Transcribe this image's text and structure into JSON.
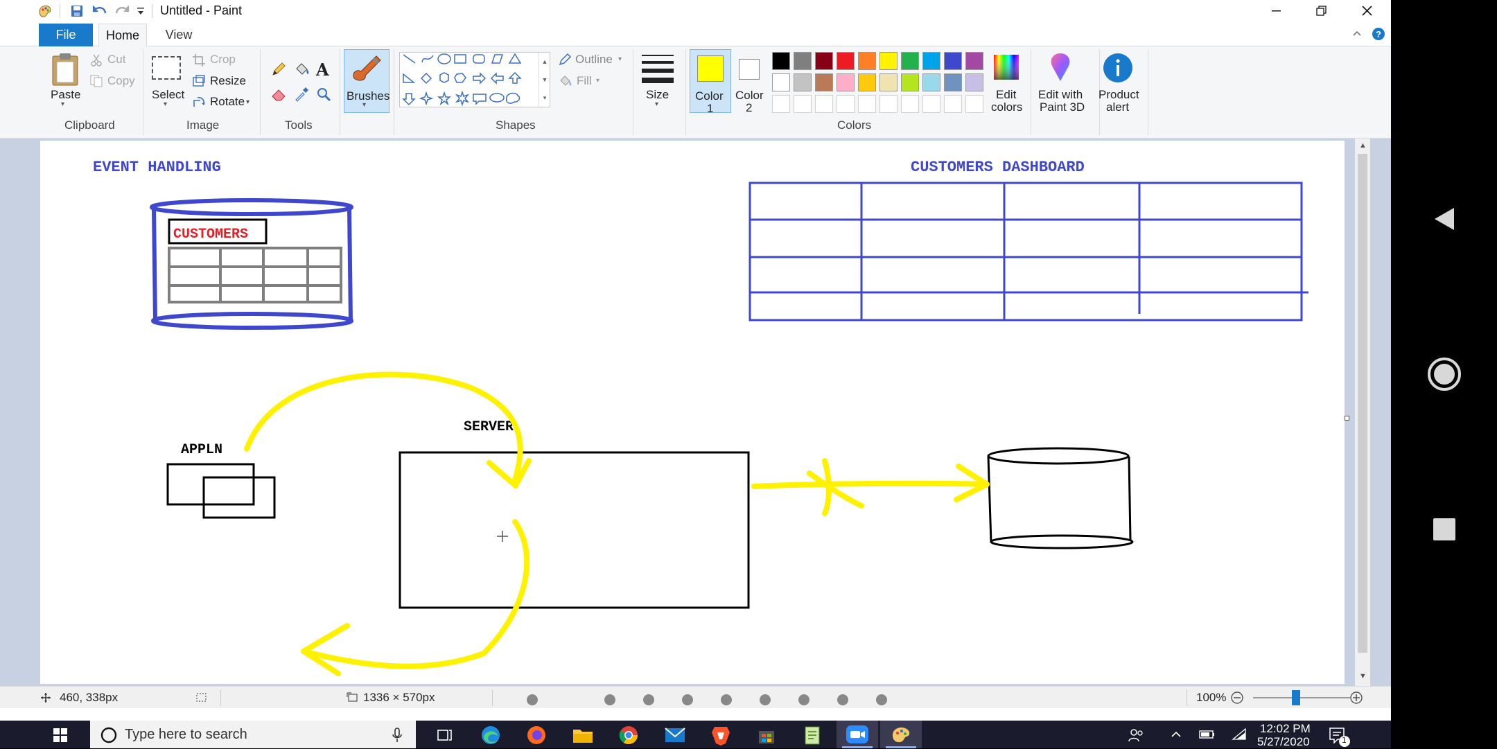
{
  "window": {
    "title": "Untitled - Paint"
  },
  "ribbon": {
    "tabs": [
      "File",
      "Home",
      "View"
    ],
    "clipboard": {
      "paste": "Paste",
      "cut": "Cut",
      "copy": "Copy",
      "group": "Clipboard"
    },
    "image": {
      "select": "Select",
      "crop": "Crop",
      "resize": "Resize",
      "rotate": "Rotate",
      "group": "Image"
    },
    "tools": {
      "group": "Tools",
      "text_glyph": "A"
    },
    "brushes": "Brushes",
    "shapes": {
      "outline": "Outline",
      "fill": "Fill",
      "group": "Shapes"
    },
    "size": "Size",
    "color1": {
      "label": "Color",
      "num": "1",
      "value": "#ffff00"
    },
    "color2": {
      "label": "Color",
      "num": "2",
      "value": "#ffffff"
    },
    "palette_row1": [
      "#000000",
      "#7f7f7f",
      "#880015",
      "#ed1c24",
      "#ff7f27",
      "#fff200",
      "#22b14c",
      "#00a2e8",
      "#3f48cc",
      "#a349a4"
    ],
    "palette_row2": [
      "#ffffff",
      "#c3c3c3",
      "#b97a57",
      "#ffaec9",
      "#ffc90e",
      "#efe4b0",
      "#b5e61d",
      "#99d9ea",
      "#7092be",
      "#c8bfe7"
    ],
    "colors_group": "Colors",
    "edit_colors": [
      "Edit",
      "colors"
    ],
    "edit_paint3d": [
      "Edit with",
      "Paint 3D"
    ],
    "product_alert": [
      "Product",
      "alert"
    ]
  },
  "canvas": {
    "title_left": "EVENT HANDLING",
    "title_right": "CUSTOMERS DASHBOARD",
    "db_label": "CUSTOMERS",
    "appln_label": "APPLN",
    "server_label": "SERVER"
  },
  "status": {
    "cursor_pos": "460, 338px",
    "canvas_size": "1336 × 570px",
    "zoom": "100%"
  },
  "taskbar": {
    "search_placeholder": "Type here to search",
    "time": "12:02 PM",
    "date": "5/27/2020",
    "notif_count": "1"
  },
  "colors": {
    "accent": "#2b579a",
    "ribbon_bg": "#f5f6f7",
    "canvas_area": "#c8d1e1",
    "drawing_blue": "#3f48cc",
    "drawing_yellow": "#fff200",
    "drawing_red": "#ed1c24",
    "taskbar": "#1b1b2e"
  }
}
